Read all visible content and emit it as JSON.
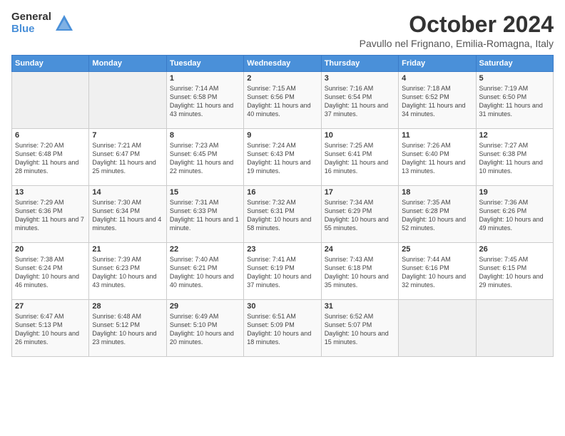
{
  "logo": {
    "general": "General",
    "blue": "Blue"
  },
  "title": "October 2024",
  "location": "Pavullo nel Frignano, Emilia-Romagna, Italy",
  "days_of_week": [
    "Sunday",
    "Monday",
    "Tuesday",
    "Wednesday",
    "Thursday",
    "Friday",
    "Saturday"
  ],
  "weeks": [
    [
      {
        "day": "",
        "sunrise": "",
        "sunset": "",
        "daylight": ""
      },
      {
        "day": "",
        "sunrise": "",
        "sunset": "",
        "daylight": ""
      },
      {
        "day": "1",
        "sunrise": "Sunrise: 7:14 AM",
        "sunset": "Sunset: 6:58 PM",
        "daylight": "Daylight: 11 hours and 43 minutes."
      },
      {
        "day": "2",
        "sunrise": "Sunrise: 7:15 AM",
        "sunset": "Sunset: 6:56 PM",
        "daylight": "Daylight: 11 hours and 40 minutes."
      },
      {
        "day": "3",
        "sunrise": "Sunrise: 7:16 AM",
        "sunset": "Sunset: 6:54 PM",
        "daylight": "Daylight: 11 hours and 37 minutes."
      },
      {
        "day": "4",
        "sunrise": "Sunrise: 7:18 AM",
        "sunset": "Sunset: 6:52 PM",
        "daylight": "Daylight: 11 hours and 34 minutes."
      },
      {
        "day": "5",
        "sunrise": "Sunrise: 7:19 AM",
        "sunset": "Sunset: 6:50 PM",
        "daylight": "Daylight: 11 hours and 31 minutes."
      }
    ],
    [
      {
        "day": "6",
        "sunrise": "Sunrise: 7:20 AM",
        "sunset": "Sunset: 6:48 PM",
        "daylight": "Daylight: 11 hours and 28 minutes."
      },
      {
        "day": "7",
        "sunrise": "Sunrise: 7:21 AM",
        "sunset": "Sunset: 6:47 PM",
        "daylight": "Daylight: 11 hours and 25 minutes."
      },
      {
        "day": "8",
        "sunrise": "Sunrise: 7:23 AM",
        "sunset": "Sunset: 6:45 PM",
        "daylight": "Daylight: 11 hours and 22 minutes."
      },
      {
        "day": "9",
        "sunrise": "Sunrise: 7:24 AM",
        "sunset": "Sunset: 6:43 PM",
        "daylight": "Daylight: 11 hours and 19 minutes."
      },
      {
        "day": "10",
        "sunrise": "Sunrise: 7:25 AM",
        "sunset": "Sunset: 6:41 PM",
        "daylight": "Daylight: 11 hours and 16 minutes."
      },
      {
        "day": "11",
        "sunrise": "Sunrise: 7:26 AM",
        "sunset": "Sunset: 6:40 PM",
        "daylight": "Daylight: 11 hours and 13 minutes."
      },
      {
        "day": "12",
        "sunrise": "Sunrise: 7:27 AM",
        "sunset": "Sunset: 6:38 PM",
        "daylight": "Daylight: 11 hours and 10 minutes."
      }
    ],
    [
      {
        "day": "13",
        "sunrise": "Sunrise: 7:29 AM",
        "sunset": "Sunset: 6:36 PM",
        "daylight": "Daylight: 11 hours and 7 minutes."
      },
      {
        "day": "14",
        "sunrise": "Sunrise: 7:30 AM",
        "sunset": "Sunset: 6:34 PM",
        "daylight": "Daylight: 11 hours and 4 minutes."
      },
      {
        "day": "15",
        "sunrise": "Sunrise: 7:31 AM",
        "sunset": "Sunset: 6:33 PM",
        "daylight": "Daylight: 11 hours and 1 minute."
      },
      {
        "day": "16",
        "sunrise": "Sunrise: 7:32 AM",
        "sunset": "Sunset: 6:31 PM",
        "daylight": "Daylight: 10 hours and 58 minutes."
      },
      {
        "day": "17",
        "sunrise": "Sunrise: 7:34 AM",
        "sunset": "Sunset: 6:29 PM",
        "daylight": "Daylight: 10 hours and 55 minutes."
      },
      {
        "day": "18",
        "sunrise": "Sunrise: 7:35 AM",
        "sunset": "Sunset: 6:28 PM",
        "daylight": "Daylight: 10 hours and 52 minutes."
      },
      {
        "day": "19",
        "sunrise": "Sunrise: 7:36 AM",
        "sunset": "Sunset: 6:26 PM",
        "daylight": "Daylight: 10 hours and 49 minutes."
      }
    ],
    [
      {
        "day": "20",
        "sunrise": "Sunrise: 7:38 AM",
        "sunset": "Sunset: 6:24 PM",
        "daylight": "Daylight: 10 hours and 46 minutes."
      },
      {
        "day": "21",
        "sunrise": "Sunrise: 7:39 AM",
        "sunset": "Sunset: 6:23 PM",
        "daylight": "Daylight: 10 hours and 43 minutes."
      },
      {
        "day": "22",
        "sunrise": "Sunrise: 7:40 AM",
        "sunset": "Sunset: 6:21 PM",
        "daylight": "Daylight: 10 hours and 40 minutes."
      },
      {
        "day": "23",
        "sunrise": "Sunrise: 7:41 AM",
        "sunset": "Sunset: 6:19 PM",
        "daylight": "Daylight: 10 hours and 37 minutes."
      },
      {
        "day": "24",
        "sunrise": "Sunrise: 7:43 AM",
        "sunset": "Sunset: 6:18 PM",
        "daylight": "Daylight: 10 hours and 35 minutes."
      },
      {
        "day": "25",
        "sunrise": "Sunrise: 7:44 AM",
        "sunset": "Sunset: 6:16 PM",
        "daylight": "Daylight: 10 hours and 32 minutes."
      },
      {
        "day": "26",
        "sunrise": "Sunrise: 7:45 AM",
        "sunset": "Sunset: 6:15 PM",
        "daylight": "Daylight: 10 hours and 29 minutes."
      }
    ],
    [
      {
        "day": "27",
        "sunrise": "Sunrise: 6:47 AM",
        "sunset": "Sunset: 5:13 PM",
        "daylight": "Daylight: 10 hours and 26 minutes."
      },
      {
        "day": "28",
        "sunrise": "Sunrise: 6:48 AM",
        "sunset": "Sunset: 5:12 PM",
        "daylight": "Daylight: 10 hours and 23 minutes."
      },
      {
        "day": "29",
        "sunrise": "Sunrise: 6:49 AM",
        "sunset": "Sunset: 5:10 PM",
        "daylight": "Daylight: 10 hours and 20 minutes."
      },
      {
        "day": "30",
        "sunrise": "Sunrise: 6:51 AM",
        "sunset": "Sunset: 5:09 PM",
        "daylight": "Daylight: 10 hours and 18 minutes."
      },
      {
        "day": "31",
        "sunrise": "Sunrise: 6:52 AM",
        "sunset": "Sunset: 5:07 PM",
        "daylight": "Daylight: 10 hours and 15 minutes."
      },
      {
        "day": "",
        "sunrise": "",
        "sunset": "",
        "daylight": ""
      },
      {
        "day": "",
        "sunrise": "",
        "sunset": "",
        "daylight": ""
      }
    ]
  ]
}
